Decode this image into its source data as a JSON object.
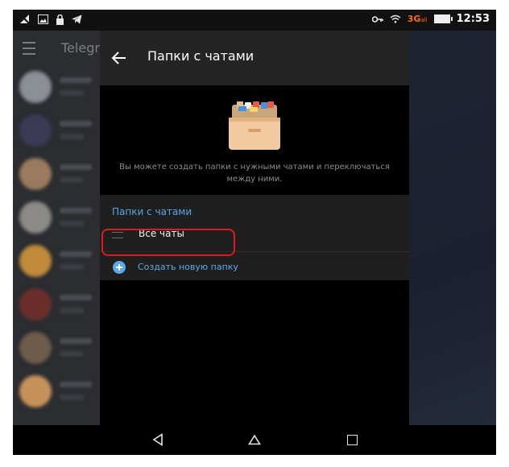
{
  "status_bar": {
    "network": "3G",
    "network_suffix": "all",
    "time": "12:53"
  },
  "background": {
    "app_title": "Telegra",
    "avatar_colors": [
      "#8b8f96",
      "#3b3a55",
      "#9a7b5f",
      "#8c8a86",
      "#c08a3a",
      "#6b2e2a",
      "#6e5b4c",
      "#c7925a"
    ]
  },
  "toolbar": {
    "title": "Папки с чатами",
    "back_icon": "arrow-left-icon"
  },
  "hero": {
    "icon": "file-cabinet-icon",
    "description": "Вы можете создать папки с нужными чатами и переключаться между ними."
  },
  "folders": {
    "header": "Папки с чатами",
    "items": [
      {
        "label": "Все чаты",
        "icon": "drag-handle-icon"
      }
    ],
    "create_label": "Создать новую папку",
    "create_icon": "plus-circle-icon"
  },
  "colors": {
    "accent": "#5aa9e8",
    "highlight": "#e01b1b",
    "toolbar_bg": "#242424"
  }
}
